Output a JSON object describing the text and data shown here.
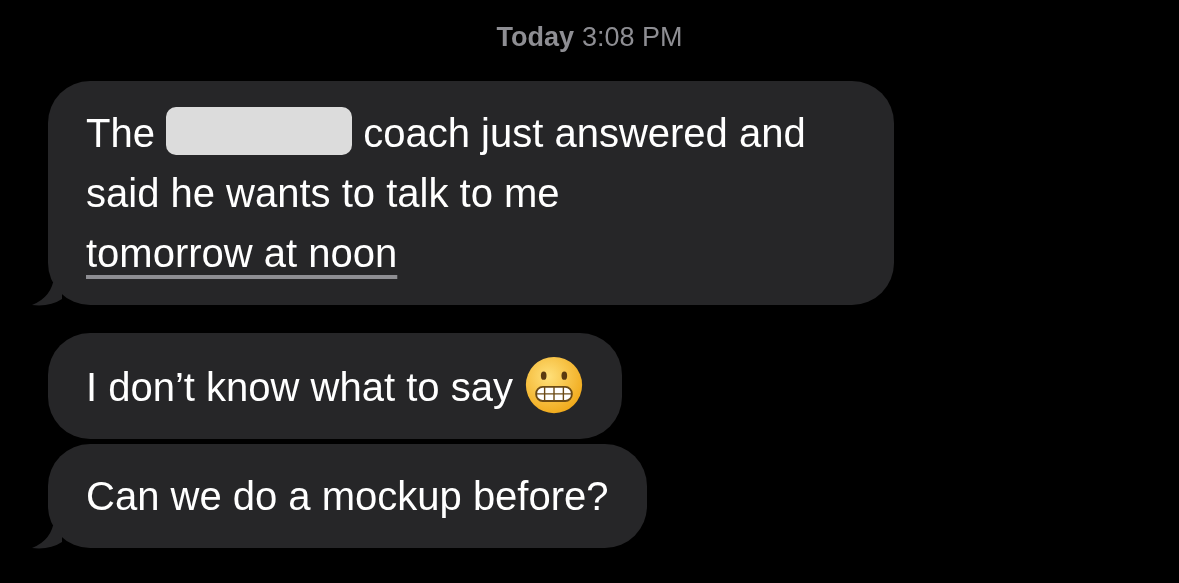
{
  "timestamp": {
    "day": "Today",
    "time": "3:08 PM"
  },
  "messages": [
    {
      "tail": true,
      "parts": [
        {
          "kind": "text",
          "text": "The"
        },
        {
          "kind": "redaction"
        },
        {
          "kind": "text",
          "text": "coach just answered and said he wants to talk to me"
        },
        {
          "kind": "link",
          "text": "tomorrow at noon"
        }
      ]
    },
    {
      "tail": false,
      "parts": [
        {
          "kind": "text",
          "text": "I don’t know what to say"
        },
        {
          "kind": "emoji"
        }
      ]
    },
    {
      "tail": true,
      "parts": [
        {
          "kind": "text",
          "text": "Can we do a mockup before?"
        }
      ]
    }
  ]
}
